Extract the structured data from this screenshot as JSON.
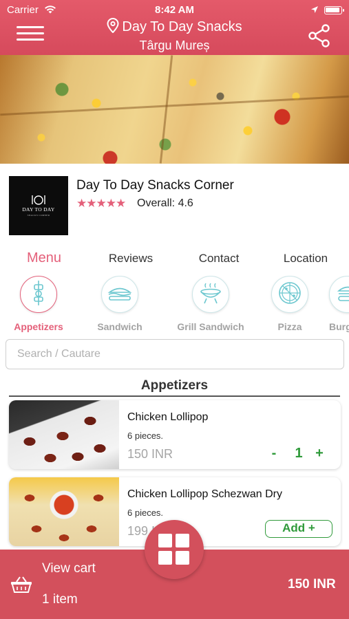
{
  "status_bar": {
    "carrier": "Carrier",
    "time": "8:42 AM"
  },
  "header": {
    "title": "Day To Day Snacks",
    "subtitle": "Târgu Mureș"
  },
  "restaurant": {
    "name": "Day To Day Snacks Corner",
    "stars": "★★★★★",
    "rating_text": "Overall: 4.6",
    "logo_text": "DAY TO DAY",
    "logo_subtext": "SNACKS CORNER"
  },
  "tabs": [
    "Menu",
    "Reviews",
    "Contact",
    "Location"
  ],
  "categories": [
    "Appetizers",
    "Sandwich",
    "Grill Sandwich",
    "Pizza",
    "Burg"
  ],
  "search": {
    "placeholder": "Search / Cautare"
  },
  "section_title": "Appetizers",
  "items": [
    {
      "name": "Chicken Lollipop",
      "desc": "6 pieces.",
      "price": "150 INR",
      "qty_minus": "-",
      "qty": "1",
      "qty_plus": "+"
    },
    {
      "name": "Chicken Lollipop Schezwan Dry",
      "desc": "6 pieces.",
      "price": "199 INR",
      "add_label": "Add +"
    }
  ],
  "cart": {
    "label": "View cart",
    "count": "1 item",
    "total": "150 INR"
  },
  "colors": {
    "accent": "#e4607a",
    "header": "#d64a5c",
    "cart": "#d3505c",
    "green": "#2f9a3a"
  }
}
